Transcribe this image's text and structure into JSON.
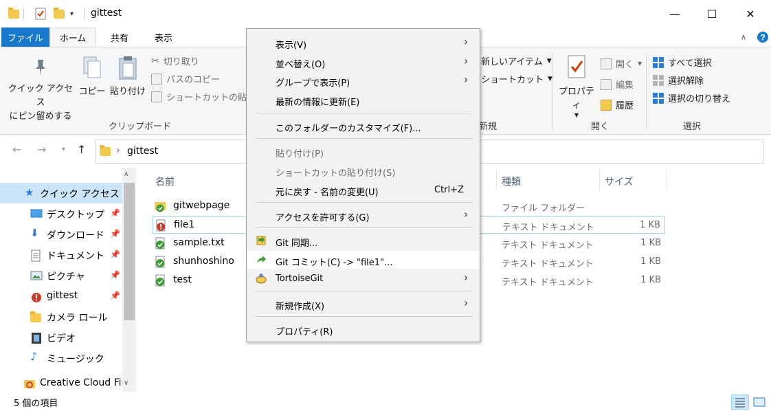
{
  "window": {
    "title": "gittest",
    "minimize": "—",
    "maximize": "☐",
    "close": "✕"
  },
  "ribbon_tabs": {
    "file": "ファイル",
    "home": "ホーム",
    "share": "共有",
    "view": "表示"
  },
  "ribbon": {
    "pin_line1": "クイック アクセス",
    "pin_line2": "にピン留めする",
    "copy": "コピー",
    "paste": "貼り付け",
    "cut": "切り取り",
    "copy_path": "パスのコピー",
    "paste_shortcut": "ショートカットの貼り付",
    "clipboard_group": "クリップボード",
    "new_item": "新しいアイテム",
    "shortcut": "ショートカット",
    "new_group": "新規",
    "properties": "プロパティ",
    "open": "開く",
    "edit": "編集",
    "history": "履歴",
    "open_group": "開く",
    "select_all": "すべて選択",
    "select_none": "選択解除",
    "invert_selection": "選択の切り替え",
    "select_group": "選択"
  },
  "address": {
    "path": "gittest",
    "separator": "›"
  },
  "nav": [
    {
      "label": "クイック アクセス",
      "selected": true
    },
    {
      "label": "デスクトップ",
      "pinned": true
    },
    {
      "label": "ダウンロード",
      "pinned": true
    },
    {
      "label": "ドキュメント",
      "pinned": true
    },
    {
      "label": "ピクチャ",
      "pinned": true
    },
    {
      "label": "gittest",
      "pinned": true
    },
    {
      "label": "カメラ ロール"
    },
    {
      "label": "ビデオ"
    },
    {
      "label": "ミュージック"
    },
    {
      "label": "Creative Cloud File"
    }
  ],
  "columns": {
    "name": "名前",
    "type": "種類",
    "size": "サイズ"
  },
  "files": [
    {
      "name": "gitwebpage",
      "type": "ファイル フォルダー",
      "size": "",
      "status": "ok"
    },
    {
      "name": "file1",
      "type": "テキスト ドキュメント",
      "size": "1 KB",
      "status": "modified"
    },
    {
      "name": "sample.txt",
      "type": "テキスト ドキュメント",
      "size": "1 KB",
      "status": "ok"
    },
    {
      "name": "shunhoshino",
      "type": "テキスト ドキュメント",
      "size": "1 KB",
      "status": "ok"
    },
    {
      "name": "test",
      "type": "テキスト ドキュメント",
      "size": "1 KB",
      "status": "ok"
    }
  ],
  "status": {
    "item_count": "5 個の項目"
  },
  "context_menu": {
    "view": "表示(V)",
    "sort_by": "並べ替え(O)",
    "group_by": "グループで表示(P)",
    "refresh": "最新の情報に更新(E)",
    "customize": "このフォルダーのカスタマイズ(F)...",
    "paste": "貼り付け(P)",
    "paste_shortcut": "ショートカットの貼り付け(S)",
    "undo": "元に戻す - 名前の変更(U)",
    "undo_shortcut": "Ctrl+Z",
    "give_access": "アクセスを許可する(G)",
    "git_sync": "Git 同期...",
    "git_commit": "Git コミット(C) -> \"file1\"...",
    "tortoisegit": "TortoiseGit",
    "new": "新規作成(X)",
    "properties": "プロパティ(R)"
  }
}
